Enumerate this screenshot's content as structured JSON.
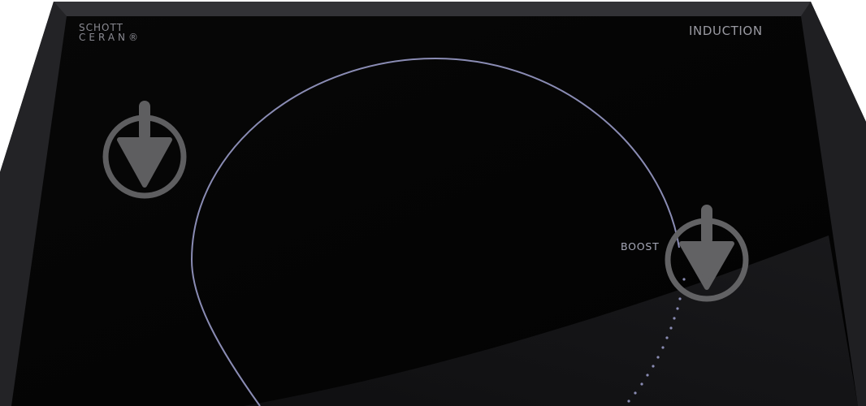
{
  "product": {
    "brand_line_1": "SCHOTT",
    "brand_line_2": "CERAN®",
    "type_label": "INDUCTION",
    "boost_label": "BOOST"
  },
  "icons": [
    "touch-control-arrow-icon",
    "touch-control-arrow-icon"
  ],
  "colors": {
    "glass": "#050505",
    "frame": "#2a2a2e",
    "zone_ring": "#8a8cb4",
    "print_text": "#9a9aa2",
    "control_symbol": "#6a6a6a"
  }
}
